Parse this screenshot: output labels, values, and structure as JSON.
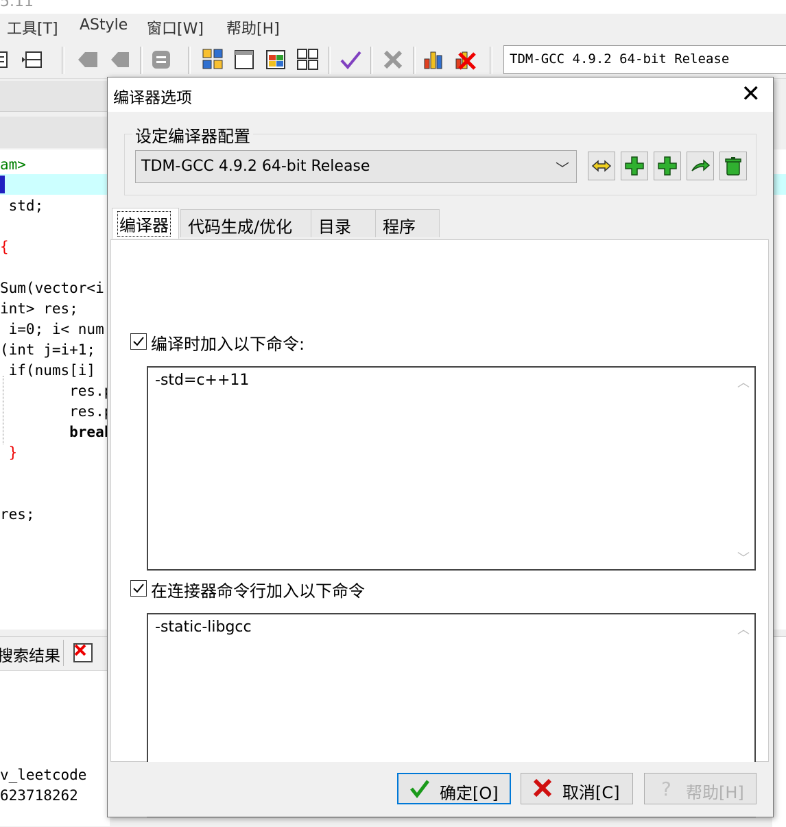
{
  "window": {
    "title_fragment": "5.11"
  },
  "menubar": {
    "items": [
      "工具[T]",
      "AStyle",
      "窗口[W]",
      "帮助[H]"
    ]
  },
  "toolbar": {
    "compiler_select": "TDM-GCC 4.9.2 64-bit Release"
  },
  "editor": {
    "lines": {
      "l1": "am>",
      "l3": " std;",
      "l4": "{",
      "l5a": "Sum(vector<i",
      "l6a": "int> res;",
      "l7a": " i=0; i< num",
      "l8a": "(int j=i+1;",
      "l9a": " if(nums[i]",
      "l10a": "        res.pus",
      "l11a": "        res.pus",
      "l12a": "        break;",
      "l13a": " }",
      "l15a": "res;"
    }
  },
  "bottom_panel": {
    "tab_label": "搜索结果",
    "output_lines": [
      "v_leetcode",
      "623718262 "
    ]
  },
  "dialog": {
    "title": "编译器选项",
    "group_label": "设定编译器配置",
    "profile_value": "TDM-GCC 4.9.2 64-bit Release",
    "tabs": [
      "编译器",
      "代码生成/优化",
      "目录",
      "程序"
    ],
    "compile_check_label": "编译时加入以下命令:",
    "compile_checked": true,
    "compile_commands": "-std=c++11",
    "linker_check_label": "在连接器命令行加入以下命令",
    "linker_checked": true,
    "linker_commands": "-static-libgcc",
    "buttons": {
      "ok": "确定[O]",
      "cancel": "取消[C]",
      "help": "帮助[H]"
    }
  },
  "colors": {
    "accent": "#0078d7",
    "highlight_line": "#ccffff",
    "keyword_red": "#e00000"
  }
}
